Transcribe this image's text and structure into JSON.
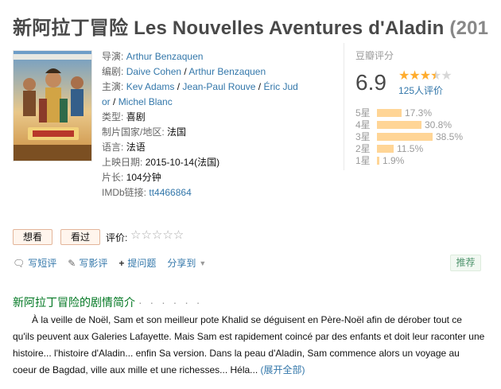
{
  "movie": {
    "title": "新阿拉丁冒险 Les Nouvelles Aventures d'Aladin",
    "year_fragment": "(201"
  },
  "info": {
    "director_label": "导演:",
    "director": "Arthur Benzaquen",
    "writer_label": "编剧:",
    "writer_1": "Daive Cohen",
    "writer_2": "Arthur Benzaquen",
    "cast_label": "主演:",
    "cast_1": "Kev Adams",
    "cast_2": "Jean-Paul Rouve",
    "cast_3_part1": "Éric Jud",
    "cast_3_part2": "or",
    "cast_4": "Michel Blanc",
    "sep": " / ",
    "genre_label": "类型:",
    "genre": "喜剧",
    "country_label": "制片国家/地区:",
    "country": "法国",
    "language_label": "语言:",
    "language": "法语",
    "release_label": "上映日期:",
    "release": "2015-10-14(法国)",
    "runtime_label": "片长:",
    "runtime": "104分钟",
    "imdb_label": "IMDb链接:",
    "imdb": "tt4466864"
  },
  "rating": {
    "label": "豆瓣评分",
    "score": "6.9",
    "stars_filled": 3.5,
    "count": "125人评价",
    "distribution": [
      {
        "label": "5星",
        "pct": "17.3%",
        "value": 17.3
      },
      {
        "label": "4星",
        "pct": "30.8%",
        "value": 30.8
      },
      {
        "label": "3星",
        "pct": "38.5%",
        "value": 38.5
      },
      {
        "label": "2星",
        "pct": "11.5%",
        "value": 11.5
      },
      {
        "label": "1星",
        "pct": "1.9%",
        "value": 1.9
      }
    ]
  },
  "buttons": {
    "want": "想看",
    "seen": "看过",
    "rate_label": "评价:",
    "rate_stars": "☆☆☆☆☆"
  },
  "actions": {
    "short_review": "写短评",
    "review": "写影评",
    "ask": "提问题",
    "share": "分享到",
    "recommend": "推荐"
  },
  "summary": {
    "title": "新阿拉丁冒险的剧情简介",
    "dots": "· · · · · ·",
    "text": "À la veille de Noël, Sam et son meilleur pote Khalid se déguisent en Père-Noël afin de dérober tout ce qu'ils peuvent aux Galeries Lafayette. Mais Sam est rapidement coincé par des enfants et doit leur raconter une histoire... l'histoire d'Aladin... enfin Sa version. Dans la peau d'Aladin, Sam commence alors un voyage au coeur de Bagdad, ville aux mille et une richesses... Héla...",
    "expand": "(展开全部)"
  },
  "colors": {
    "link": "#3377aa",
    "green_title": "#007722",
    "star": "#ffac2d",
    "bar": "#ffd596"
  }
}
